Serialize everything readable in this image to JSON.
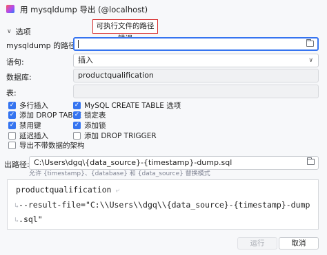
{
  "window": {
    "title": "用 mysqldump 导出 (@localhost)",
    "icon": "datagrip-app-icon"
  },
  "error_tooltip": "可执行文件的路径错误",
  "section": {
    "label": "选项",
    "icon": "chevron-down-icon"
  },
  "fields": {
    "path": {
      "label": "mysqldump 的路径:",
      "value": "",
      "browse_icon": "folder-icon"
    },
    "statement": {
      "label": "语句:",
      "value": "插入",
      "icon": "chevron-down-icon"
    },
    "database": {
      "label": "数据库:",
      "value": "productqualification"
    },
    "table": {
      "label": "表:",
      "value": ""
    }
  },
  "options": {
    "left": [
      {
        "label": "多行插入",
        "checked": true
      },
      {
        "label": "添加 DROP TABLE",
        "checked": true
      },
      {
        "label": "禁用键",
        "checked": true
      },
      {
        "label": "延迟插入",
        "checked": false
      },
      {
        "label": "导出不带数据的架构",
        "checked": false
      }
    ],
    "right": [
      {
        "label": "MySQL CREATE TABLE 选项",
        "checked": true
      },
      {
        "label": "锁定表",
        "checked": true
      },
      {
        "label": "添加锁",
        "checked": true
      },
      {
        "label": "添加 DROP TRIGGER",
        "checked": false
      }
    ]
  },
  "output": {
    "label": "出路径:",
    "value": "C:\\Users\\dgq\\{data_source}-{timestamp}-dump.sql",
    "hint": "允许 {timestamp}、{database} 和 {data_source} 替换模式",
    "browse_icon": "folder-icon"
  },
  "command": {
    "lines": [
      "productqualification",
      "--result-file=\"C:\\\\Users\\\\dgq\\\\{data_source}-{timestamp}-dump",
      ".sql\""
    ],
    "wrap_icon": "soft-wrap-icon"
  },
  "buttons": {
    "run": "运行",
    "cancel": "取消"
  },
  "colors": {
    "accent": "#3574f0",
    "error_border": "#d72b2b",
    "background": "#f7f8fa"
  }
}
